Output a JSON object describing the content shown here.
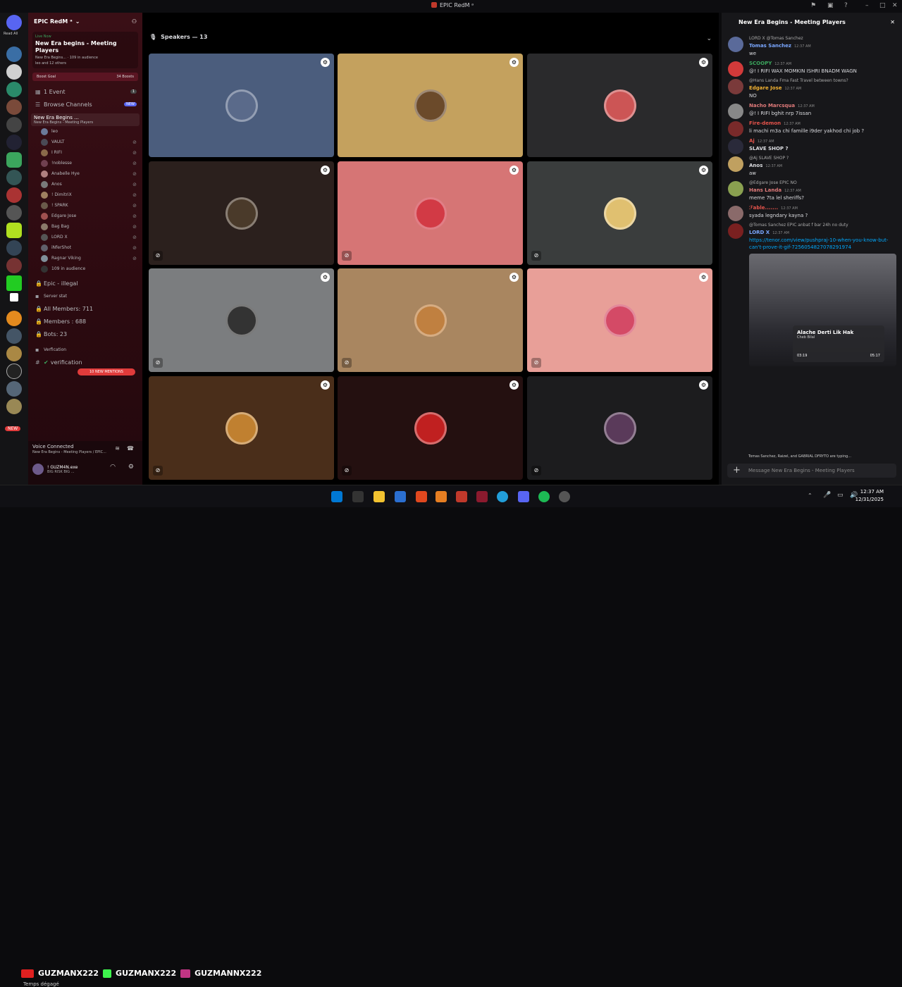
{
  "window": {
    "title": "EPIC RedM ᵃ"
  },
  "server": {
    "name": "EPIC RedM ᵃ",
    "read_all": "Read All",
    "live_now": "Live Now",
    "event_title": "New Era begins - Meeting Players",
    "event_sub": "New Era Begins... · 109 in audience",
    "event_attend": "leo and 12 others",
    "boost_goal": "Boost Goal",
    "boosts": "34 Boosts",
    "events": "1 Event",
    "events_count": "1",
    "browse": "Browse Channels",
    "browse_badge": "NEW",
    "stage_name": "New Era Begins ...",
    "stage_sub": "New Era Begins - Meeting Players",
    "users": [
      "leo",
      "VAULT",
      "I RIFI",
      "!noblesse",
      "Anabelle Hye",
      "Anos",
      "! DimitriX",
      "! SPARK",
      "Edgare Jose",
      "Bag Bag",
      "LORD X",
      "iNferShot",
      "Ragnar Viking"
    ],
    "audience": "109 in audience",
    "ch_illegal": "Epic - illegal",
    "server_stat": "Server stat",
    "all_members": "All Members: 711",
    "members": "Members : 688",
    "bots": "Bots: 23",
    "verification_cat": "Verfication",
    "verification": "verification",
    "mentions": "10 NEW MENTIONS"
  },
  "voice": {
    "connected": "Voice Connected",
    "channel": "New Era Begins - Meeting Players / EPIC...",
    "user": "! GUZM4N.exe",
    "status": "BIG RISK BIG ..."
  },
  "stage": {
    "speakers_label": "Speakers — 13",
    "tile_colors": [
      "#4b5d7d",
      "#c4a15e",
      "#2a2a2c",
      "#2b201d",
      "#d67575",
      "#3a3d3d",
      "#7b7d7f",
      "#a98660",
      "#e89f98",
      "#4a2e1a",
      "#241010",
      "#1c1c1e"
    ],
    "avatar_colors": [
      "#5a6a8a",
      "#6b4a2a",
      "#c55",
      "#4a3a2a",
      "#d23a45",
      "#e0c070",
      "#333",
      "#c08040",
      "#d44a66",
      "#c08030",
      "#c02020",
      "#5a3a5a"
    ]
  },
  "chat": {
    "title": "New Era Begins - Meeting Players",
    "messages": [
      {
        "reply": "LORD X @Tomas Sanchez",
        "author": "Tomas Sanchez",
        "time": "12:37 AM",
        "text": "we",
        "color": "#7aa7ff"
      },
      {
        "reply": "",
        "author": "SCOOPY",
        "time": "12:37 AM",
        "text": "@! I RIFI WAX MOMKIN ISHRI BNADM WAGN",
        "color": "#3ba55d"
      },
      {
        "reply": "@Hans Landa Fma Fast Travel between towns?",
        "author": "Edgare Jose",
        "time": "12:37 AM",
        "text": "NO",
        "color": "#f0b132"
      },
      {
        "reply": "",
        "author": "Nacho Marcsqua",
        "time": "12:37 AM",
        "text": "@! I RIFI bghit nrp 7issan",
        "color": "#e07a7a"
      },
      {
        "reply": "",
        "author": "Fire-demon",
        "time": "12:37 AM",
        "text": "li machi m3a chi famille i9der yakhod chi job ?",
        "color": "#e5534b"
      },
      {
        "reply": "",
        "author": "Aj",
        "time": "12:37 AM",
        "text": "SLAVE SHOP ?",
        "color": "#e5534b"
      },
      {
        "reply": "@Aj SLAVE SHOP ?",
        "author": "Anos",
        "time": "12:37 AM",
        "text": "aw",
        "color": "#dcdde1"
      },
      {
        "reply": "@Edgare Jose EPIC NO",
        "author": "Hans Landa",
        "time": "12:37 AM",
        "text": "meme 7ta lel sheriffs?",
        "color": "#e07a7a"
      },
      {
        "reply": "",
        "author": "ℱable.......",
        "time": "12:37 AM",
        "text": "syada legndary kayna ?",
        "color": "#e5534b"
      },
      {
        "reply": "@Tomas Sanchez EPIC anbat f bar 24h no duty",
        "author": "LORD X",
        "time": "12:37 AM",
        "text": "https://tenor.com/view/pushpraj-10-when-you-know-but-can't-prove-it-gif-7256054827078291974",
        "color": "#7aa7ff"
      }
    ],
    "now_playing": {
      "title": "Alache Derti Lik Hak",
      "artist": "Cheb Bilal",
      "elapsed": "03:19",
      "total": "05:17"
    },
    "typing": "Tomas Sanchez, Raizel, and GABRIAL DFRYTO are typing...",
    "placeholder": "Message New Era Begins - Meeting Players"
  },
  "promo": [
    "GUZMANX222",
    "GUZMANX222",
    "GUZMANNX222"
  ],
  "weather": "Temps dégagé",
  "clock": {
    "time": "12:37 AM",
    "date": "12/31/2025"
  }
}
